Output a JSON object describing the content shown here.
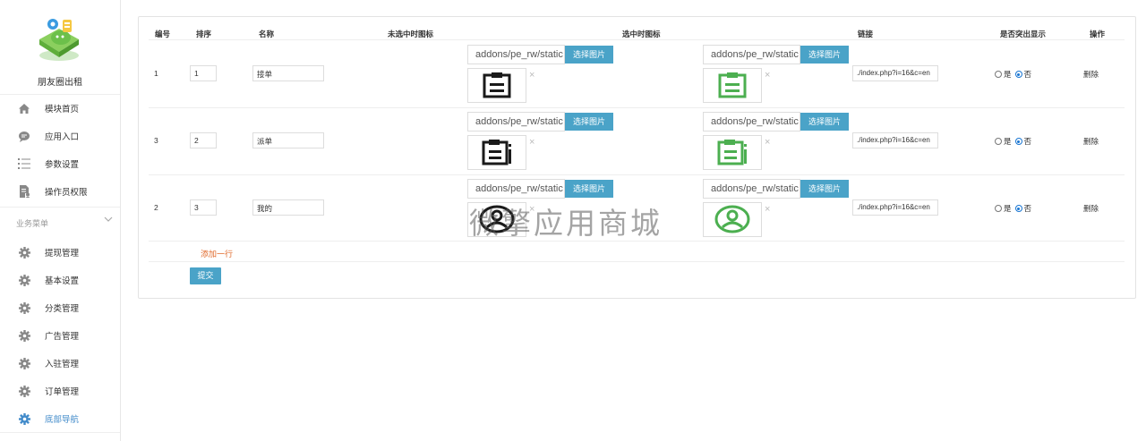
{
  "sidebar": {
    "app_name": "朋友圈出租",
    "top_items": [
      {
        "label": "模块首页",
        "icon": "home-icon"
      },
      {
        "label": "应用入口",
        "icon": "chat-bubble-icon"
      },
      {
        "label": "参数设置",
        "icon": "list-settings-icon"
      },
      {
        "label": "操作员权限",
        "icon": "document-user-icon"
      }
    ],
    "section_title": "业务菜单",
    "menu_items": [
      {
        "label": "提现管理",
        "icon": "gear-icon"
      },
      {
        "label": "基本设置",
        "icon": "gear-icon"
      },
      {
        "label": "分类管理",
        "icon": "gear-icon"
      },
      {
        "label": "广告管理",
        "icon": "gear-icon"
      },
      {
        "label": "入驻管理",
        "icon": "gear-icon"
      },
      {
        "label": "订单管理",
        "icon": "gear-icon"
      },
      {
        "label": "底部导航",
        "icon": "gear-icon",
        "active": true
      }
    ],
    "active_color": "#428bca"
  },
  "table": {
    "headers": {
      "id": "编号",
      "sort": "排序",
      "name": "名称",
      "icon_unselected": "未选中时图标",
      "icon_selected": "选中时图标",
      "link": "链接",
      "highlight": "是否突出显示",
      "action": "操作"
    },
    "rows": [
      {
        "id": "1",
        "sort": "1",
        "name": "接单",
        "icon_unselected_path": "addons/pe_rw/static",
        "icon_selected_path": "addons/pe_rw/static",
        "icon_unselected": "clipboard-icon",
        "icon_selected": "clipboard-icon",
        "link": "./index.php?i=16&c=en",
        "highlight": "否",
        "remove_symbol": "×"
      },
      {
        "id": "3",
        "sort": "2",
        "name": "派单",
        "icon_unselected_path": "addons/pe_rw/static",
        "icon_selected_path": "addons/pe_rw/static",
        "icon_unselected": "clipboard-info-icon",
        "icon_selected": "clipboard-info-icon",
        "link": "./index.php?i=16&c=en",
        "highlight": "否",
        "remove_symbol": "×"
      },
      {
        "id": "2",
        "sort": "3",
        "name": "我的",
        "icon_unselected_path": "addons/pe_rw/static",
        "icon_selected_path": "addons/pe_rw/static",
        "icon_unselected": "user-circle-icon",
        "icon_selected": "user-circle-icon",
        "link": "./index.php?i=16&c=en",
        "highlight": "否",
        "remove_symbol": "×"
      }
    ],
    "pick_button_label": "选择图片",
    "radio_yes": "是",
    "radio_no": "否",
    "delete_label": "删除",
    "add_row_label": "添加一行",
    "submit_label": "提交"
  },
  "watermark": "微擎应用商城",
  "colors": {
    "icon_dark": "#1a1a1a",
    "icon_green": "#4caf50",
    "button_blue": "#4aa3c8",
    "add_row": "#e0692a"
  }
}
